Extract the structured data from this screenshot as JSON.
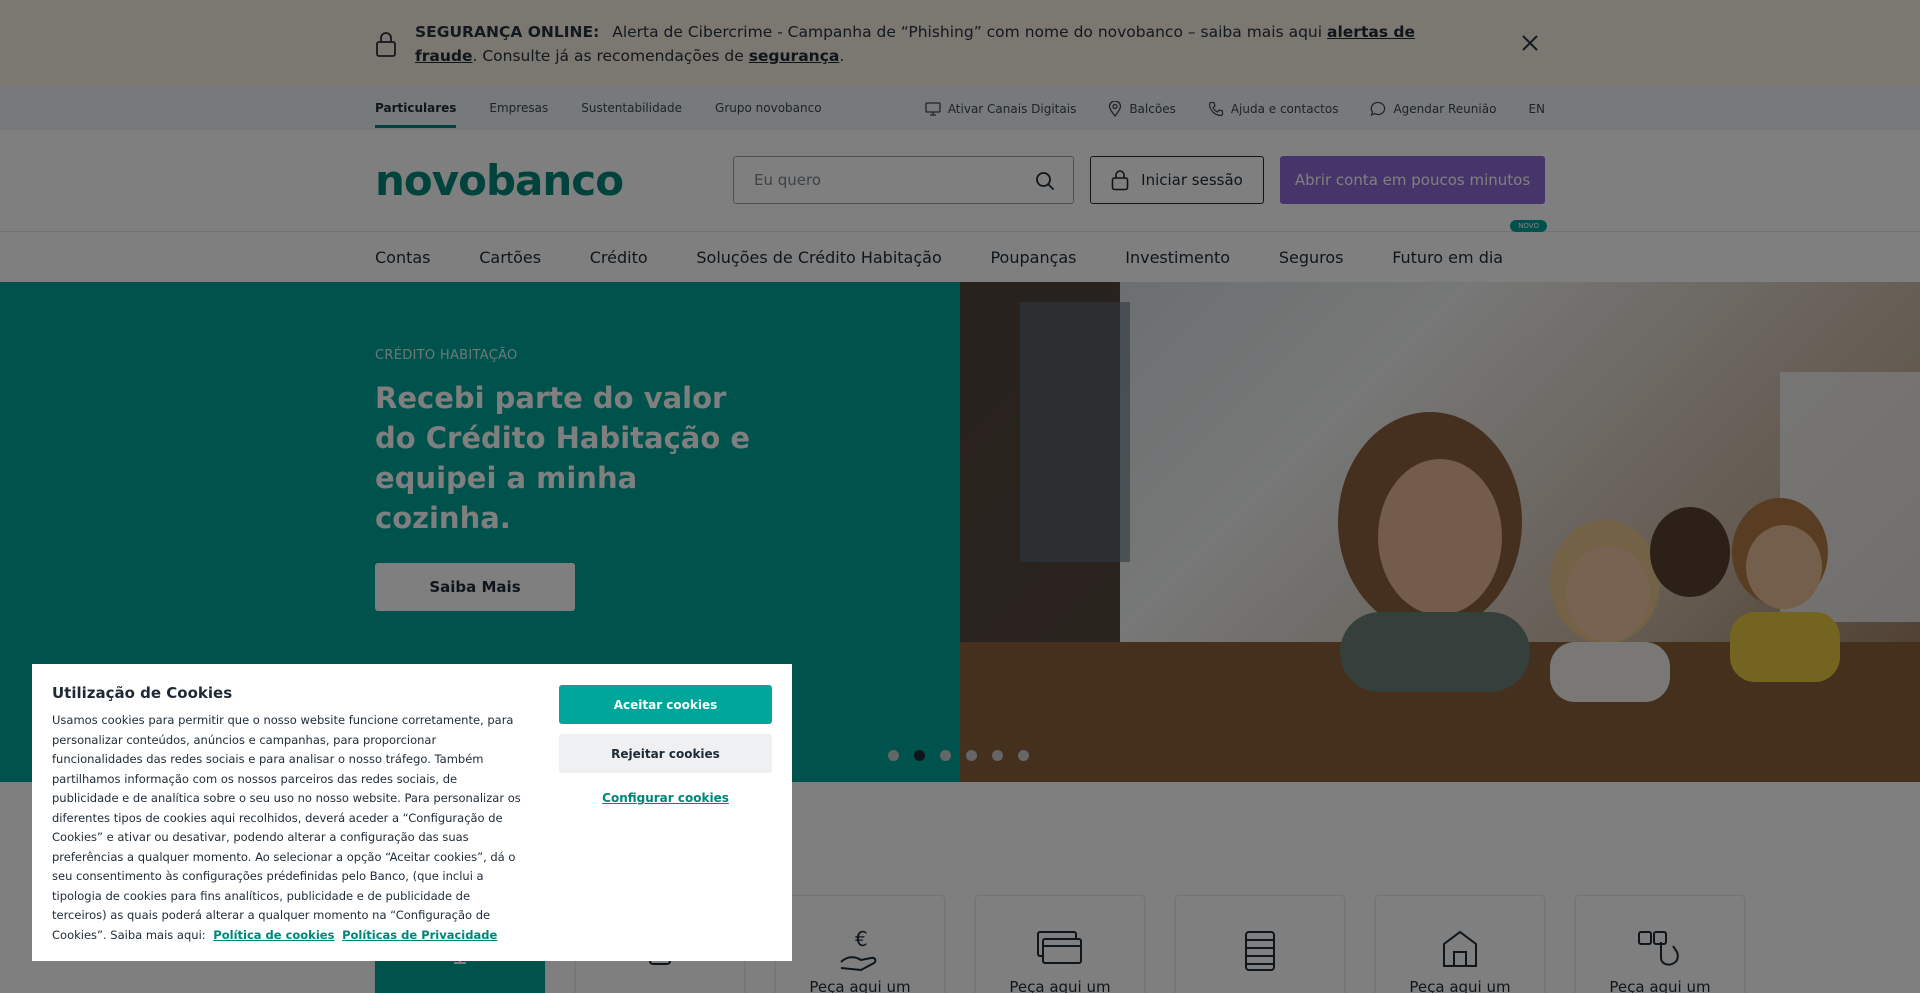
{
  "alert": {
    "title": "SEGURANÇA ONLINE:",
    "text_before": "Alerta de Cibercrime - Campanha de “Phishing” com nome do novobanco – saiba mais aqui",
    "link_fraud": "alertas de fraude",
    "text_middle": ". Consulte já as recomendações de",
    "link_security": "segurança",
    "text_end": "."
  },
  "util_nav": {
    "segments": [
      "Particulares",
      "Empresas",
      "Sustentabilidade",
      "Grupo novobanco"
    ],
    "links": [
      "Ativar Canais Digitais",
      "Balcões",
      "Ajuda e contactos",
      "Agendar Reunião"
    ],
    "lang": "EN"
  },
  "header": {
    "logo": "novobanco",
    "search_placeholder": "Eu quero",
    "login_label": "Iniciar sessão",
    "open_account_label": "Abrir conta em poucos minutos"
  },
  "main_nav": {
    "items": [
      "Contas",
      "Cartões",
      "Crédito",
      "Soluções de Crédito Habitação",
      "Poupanças",
      "Investimento",
      "Seguros",
      "Futuro em dia"
    ],
    "new_badge": "NOVO"
  },
  "hero": {
    "eyebrow": "CRÉDITO HABITAÇÃO",
    "title": "Recebi parte do valor do Crédito Habitação e equipei a minha cozinha.",
    "button": "Saiba Mais",
    "slides_count": 6,
    "active_slide": 2
  },
  "cards": {
    "items": [
      "",
      "",
      "Peça aqui um",
      "Peça aqui um",
      "",
      "Peça aqui um",
      "Peça aqui um"
    ]
  },
  "cookie": {
    "title": "Utilização de Cookies",
    "text": "Usamos cookies para permitir que o nosso website funcione corretamente, para personalizar conteúdos, anúncios e campanhas, para proporcionar funcionalidades das redes sociais e para analisar o nosso tráfego. Também partilhamos informação com os nossos parceiros das redes sociais, de publicidade e de analítica sobre o seu uso no nosso website. Para personalizar os diferentes tipos de cookies aqui recolhidos, deverá aceder a “Configuração de Cookies” e ativar ou desativar, podendo alterar a configuração das suas preferências a qualquer momento. Ao selecionar a opção “Aceitar cookies”, dá o seu consentimento às configurações prédefinidas pelo Banco, (que inclui a tipologia de cookies para fins analíticos, publicidade e de publicidade de terceiros) as quais poderá alterar a qualquer momento na “Configuração de Cookies”. Saiba mais aqui:",
    "link_cookies_policy": "Política de cookies",
    "link_privacy": "Políticas de Privacidade",
    "accept": "Aceitar cookies",
    "reject": "Rejeitar cookies",
    "configure": "Configurar cookies"
  },
  "colors": {
    "brand": "#00877b",
    "hero_teal": "#00a69a",
    "cta_purple": "#8b6bd4"
  }
}
